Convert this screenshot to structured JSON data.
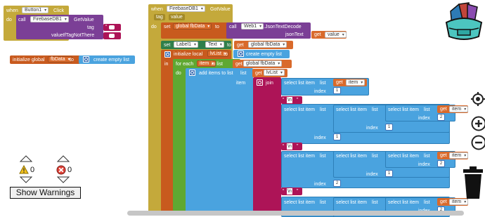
{
  "click_event": {
    "when": "when",
    "component": "Button1",
    "event": "Click",
    "do": "do",
    "call": "call",
    "db_component": "FirebaseDB1",
    "method": "GetValue",
    "param_tag": "tag",
    "param_value_if": "valueIfTagNotThere"
  },
  "init_global": {
    "label": "initialize global",
    "var": "fbData",
    "to": "to",
    "value": "create empty list"
  },
  "got_value": {
    "when": "when",
    "component": "FirebaseDB1",
    "event": "GotValue",
    "param_tag": "tag",
    "param_value": "value",
    "do": "do",
    "set_global": "set",
    "set_var": "global fbData",
    "to": "to",
    "call": "call",
    "web_component": "Web1",
    "method": ".JsonTextDecode",
    "json_text": "jsonText",
    "get": "get",
    "get_var": "value"
  },
  "set_label": {
    "set": "set",
    "component": "Label1",
    "property": "Text",
    "to": "to",
    "get": "get",
    "get_var": "global fbData"
  },
  "init_local": {
    "label": "initialize local",
    "var": "lvList",
    "to": "to",
    "value": "create empty list",
    "in": "in"
  },
  "for_each": {
    "label": "for each",
    "var": "item",
    "in_list": "in list",
    "get": "get",
    "get_var": "global fbData",
    "do": "do"
  },
  "add_items": {
    "label": "add items to list",
    "list": "list",
    "get": "get",
    "get_var": "lvList",
    "item": "item",
    "join": "join"
  },
  "select_item": {
    "label": "select list item",
    "list": "list",
    "index": "index",
    "get": "get",
    "item_var": "item"
  },
  "join_text": {
    "newline": "\\n"
  },
  "numbers": {
    "one": "1",
    "two": "2"
  },
  "warnings": {
    "warning_count": "0",
    "error_count": "0",
    "button": "Show Warnings"
  }
}
